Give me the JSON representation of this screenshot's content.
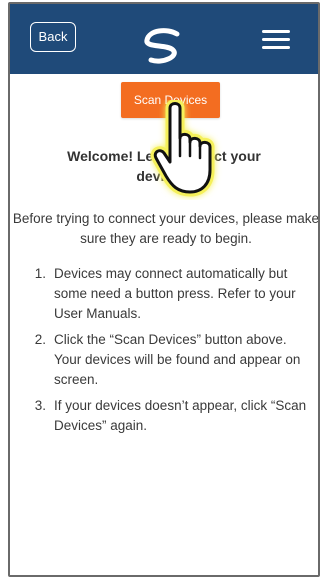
{
  "header": {
    "back_label": "Back",
    "logo_icon": "brand-swoosh-logo",
    "menu_icon": "hamburger-menu-icon",
    "background_color": "#1f4a79"
  },
  "main": {
    "scan_button_label": "Scan Devices",
    "scan_button_color": "#f36d21",
    "welcome_line1": "Welcome! Let's connect your",
    "welcome_line2": "devices.",
    "intro": "Before trying to connect your devices, please make sure they are ready to begin.",
    "steps": [
      {
        "number": "1.",
        "text": "Devices may connect automatically but some need a button press. Refer to your User Manuals."
      },
      {
        "number": "2.",
        "text": "Click the “Scan Devices” button above. Your devices will be found and appear on screen."
      },
      {
        "number": "3.",
        "text": "If your devices doesn’t appear, click “Scan Devices” again."
      }
    ]
  },
  "overlay": {
    "pointer_icon": "tap-hand-icon",
    "highlight_color": "#f5f05a"
  }
}
